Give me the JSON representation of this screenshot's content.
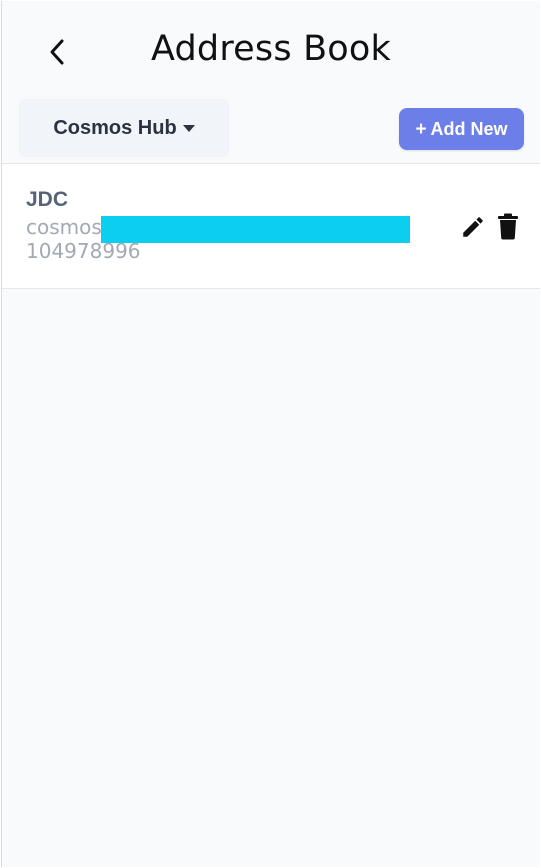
{
  "header": {
    "title": "Address Book",
    "back_icon": "chevron-left-icon"
  },
  "toolbar": {
    "chain_selector": {
      "selected": "Cosmos Hub",
      "icon": "caret-down-icon"
    },
    "add_button": {
      "label": "Add New",
      "icon": "plus-icon"
    }
  },
  "contacts": [
    {
      "name": "JDC",
      "address_prefix": "cosmos",
      "address_suffix": "104978996",
      "edit_icon": "pencil-icon",
      "delete_icon": "trash-icon"
    }
  ],
  "colors": {
    "accent": "#6c7ee8",
    "background": "#f8fafc",
    "redaction": "#0ccff0"
  }
}
